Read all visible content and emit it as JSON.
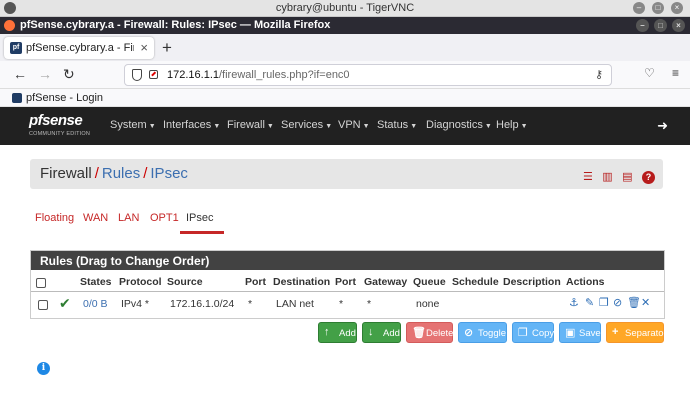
{
  "vnc": {
    "title": "cybrary@ubuntu - TigerVNC"
  },
  "browser": {
    "window_title": "pfSense.cybrary.a - Firewall: Rules: IPsec — Mozilla Firefox",
    "tab_title": "pfSense.cybrary.a - Firew",
    "tab_close": "×",
    "new_tab": "+",
    "url_host": "172.16.1.1",
    "url_path": "/firewall_rules.php?if=enc0",
    "bookmark": "pfSense - Login"
  },
  "pfsense": {
    "logo_main": "pfsense",
    "logo_sub": "COMMUNITY EDITION",
    "menu": [
      "System",
      "Interfaces",
      "Firewall",
      "Services",
      "VPN",
      "Status",
      "Diagnostics",
      "Help"
    ]
  },
  "breadcrumb": {
    "firewall": "Firewall",
    "rules": "Rules",
    "ipsec": "IPsec",
    "sep": "/"
  },
  "subtabs": [
    "Floating",
    "WAN",
    "LAN",
    "OPT1",
    "IPsec"
  ],
  "active_subtab": "IPsec",
  "rules": {
    "heading": "Rules (Drag to Change Order)",
    "columns": [
      "States",
      "Protocol",
      "Source",
      "Port",
      "Destination",
      "Port",
      "Gateway",
      "Queue",
      "Schedule",
      "Description",
      "Actions"
    ],
    "rows": [
      {
        "states": "0/0 B",
        "protocol": "IPv4 *",
        "source": "172.16.1.0/24",
        "port": "*",
        "destination": "LAN net",
        "dest_port": "*",
        "gateway": "*",
        "queue": "none",
        "schedule": "",
        "description": ""
      }
    ]
  },
  "buttons": {
    "add_top": "Add",
    "add_bottom": "Add",
    "delete": "Delete",
    "toggle": "Toggle",
    "copy": "Copy",
    "save": "Save",
    "separator": "Separator"
  },
  "colors": {
    "accent": "#c62828",
    "navbar": "#212121",
    "link": "#3c6fb0"
  }
}
